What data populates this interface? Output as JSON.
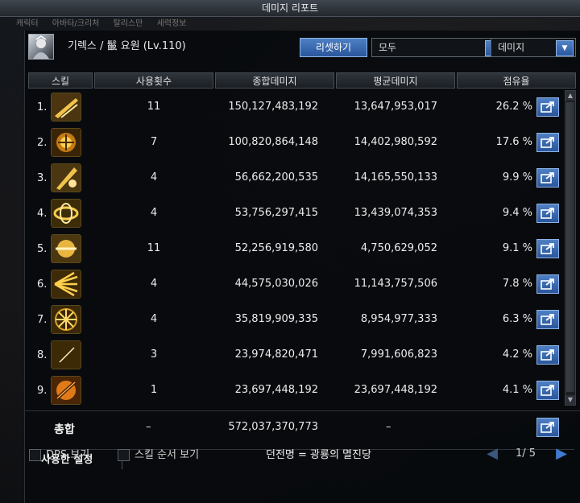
{
  "window": {
    "title": "데미지 리포트"
  },
  "hud_tabs": [
    "캐릭터",
    "아바타/크리처",
    "탈리스만",
    "세력정보"
  ],
  "header": {
    "character": "기렉스 / 鬣 요원 (Lv.110)",
    "reset_label": "리셋하기",
    "filter_value": "모두",
    "sort_value": "데미지"
  },
  "columns": [
    "스킬",
    "사용횟수",
    "종합데미지",
    "평균데미지",
    "점유율"
  ],
  "rows": [
    {
      "rank": "1.",
      "icon": "slash-skill-icon",
      "uses": "11",
      "total": "150,127,483,192",
      "avg": "13,647,953,017",
      "share": "26.2 %"
    },
    {
      "rank": "2.",
      "icon": "orb-glyph-skill-icon",
      "uses": "7",
      "total": "100,820,864,148",
      "avg": "14,402,980,592",
      "share": "17.6 %"
    },
    {
      "rank": "3.",
      "icon": "blade-skill-icon",
      "uses": "4",
      "total": "56,662,200,535",
      "avg": "14,165,550,133",
      "share": "9.9 %"
    },
    {
      "rank": "4.",
      "icon": "whirl-skill-icon",
      "uses": "4",
      "total": "53,756,297,415",
      "avg": "13,439,074,353",
      "share": "9.4 %"
    },
    {
      "rank": "5.",
      "icon": "disc-skill-icon",
      "uses": "11",
      "total": "52,256,919,580",
      "avg": "4,750,629,052",
      "share": "9.1 %"
    },
    {
      "rank": "6.",
      "icon": "burst-skill-icon",
      "uses": "4",
      "total": "44,575,030,026",
      "avg": "11,143,757,506",
      "share": "7.8 %"
    },
    {
      "rank": "7.",
      "icon": "star-skill-icon",
      "uses": "4",
      "total": "35,819,909,335",
      "avg": "8,954,977,333",
      "share": "6.3 %"
    },
    {
      "rank": "8.",
      "icon": "crescent-skill-icon",
      "uses": "3",
      "total": "23,974,820,471",
      "avg": "7,991,606,823",
      "share": "4.2 %"
    },
    {
      "rank": "9.",
      "icon": "flame-slash-skill-icon",
      "uses": "1",
      "total": "23,697,448,192",
      "avg": "23,697,448,192",
      "share": "4.1 %"
    }
  ],
  "totals": {
    "label": "총합",
    "uses": "–",
    "total": "572,037,370,773",
    "avg": "–"
  },
  "settings_tab": "사용한 설정",
  "footer": {
    "dps_label": "DPS 보기",
    "skill_order_label": "스킬 순서 보기",
    "dungeon": "던전명 = 광룡의 멸진당",
    "page": "1/ 5"
  },
  "colors": {
    "accent": "#2f64b6",
    "header_bg": "#2a2f35",
    "icon_gold": "#d9a325"
  }
}
